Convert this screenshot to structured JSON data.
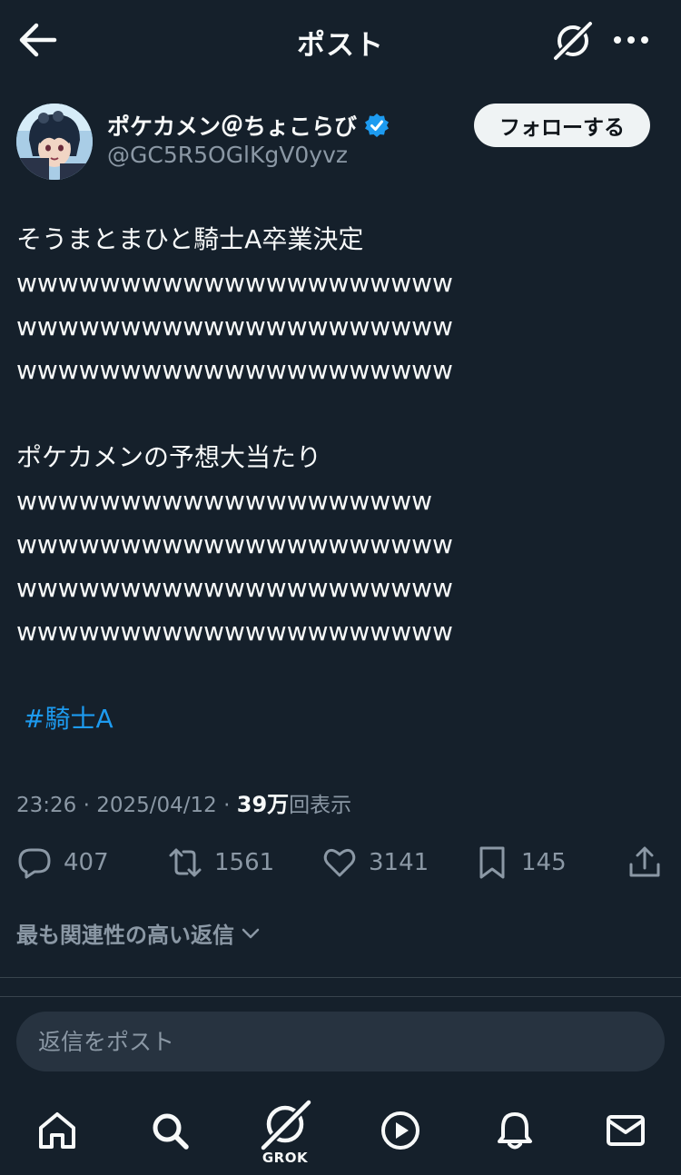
{
  "header": {
    "title": "ポスト"
  },
  "author": {
    "name": "ポケカメン＠ちょこらび",
    "handle": "@GC5R5OGlKgV0yvz",
    "follow_label": "フォローする"
  },
  "post": {
    "lines": [
      "そうまとまひと騎士A卒業決定",
      "wwwwwwwwwwwwwwwwwwwww",
      "wwwwwwwwwwwwwwwwwwwww",
      "wwwwwwwwwwwwwwwwwwwww",
      "",
      "ポケカメンの予想大当たり",
      "wwwwwwwwwwwwwwwwwwww",
      "wwwwwwwwwwwwwwwwwwwww",
      "wwwwwwwwwwwwwwwwwwwww",
      "wwwwwwwwwwwwwwwwwwwww"
    ],
    "hashtag": "#騎士A"
  },
  "meta": {
    "time": "23:26",
    "sep1": "·",
    "date": "2025/04/12",
    "sep2": "·",
    "views": "39万",
    "views_label": "回表示"
  },
  "actions": {
    "replies": "407",
    "reposts": "1561",
    "likes": "3141",
    "bookmarks": "145"
  },
  "replies_sort": {
    "label": "最も関連性の高い返信"
  },
  "reply_box": {
    "placeholder": "返信をポスト"
  },
  "tabbar": {
    "grok_label": "GROK"
  },
  "colors": {
    "background": "#15202b",
    "accent": "#1d9bf0",
    "muted": "#8b98a5"
  }
}
